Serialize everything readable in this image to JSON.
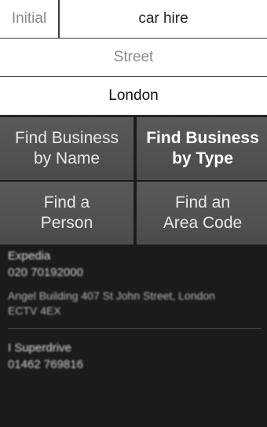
{
  "search": {
    "initial_placeholder": "Initial",
    "what_value": "car hire",
    "street_placeholder": "Street",
    "town_value": "London"
  },
  "buttons": [
    {
      "label": "Find Business\nby Name",
      "bold": false
    },
    {
      "label": "Find Business\nby Type",
      "bold": true
    },
    {
      "label": "Find a\nPerson",
      "bold": false
    },
    {
      "label": "Find an\nArea Code",
      "bold": false
    }
  ],
  "results": [
    {
      "name": "Expedia",
      "phone": "020 70192000",
      "address_line1": "Angel Building 407 St John Street, London",
      "address_line2": "ECTV 4EX"
    },
    {
      "name": "I Superdrive",
      "phone": "01462 769816"
    }
  ]
}
